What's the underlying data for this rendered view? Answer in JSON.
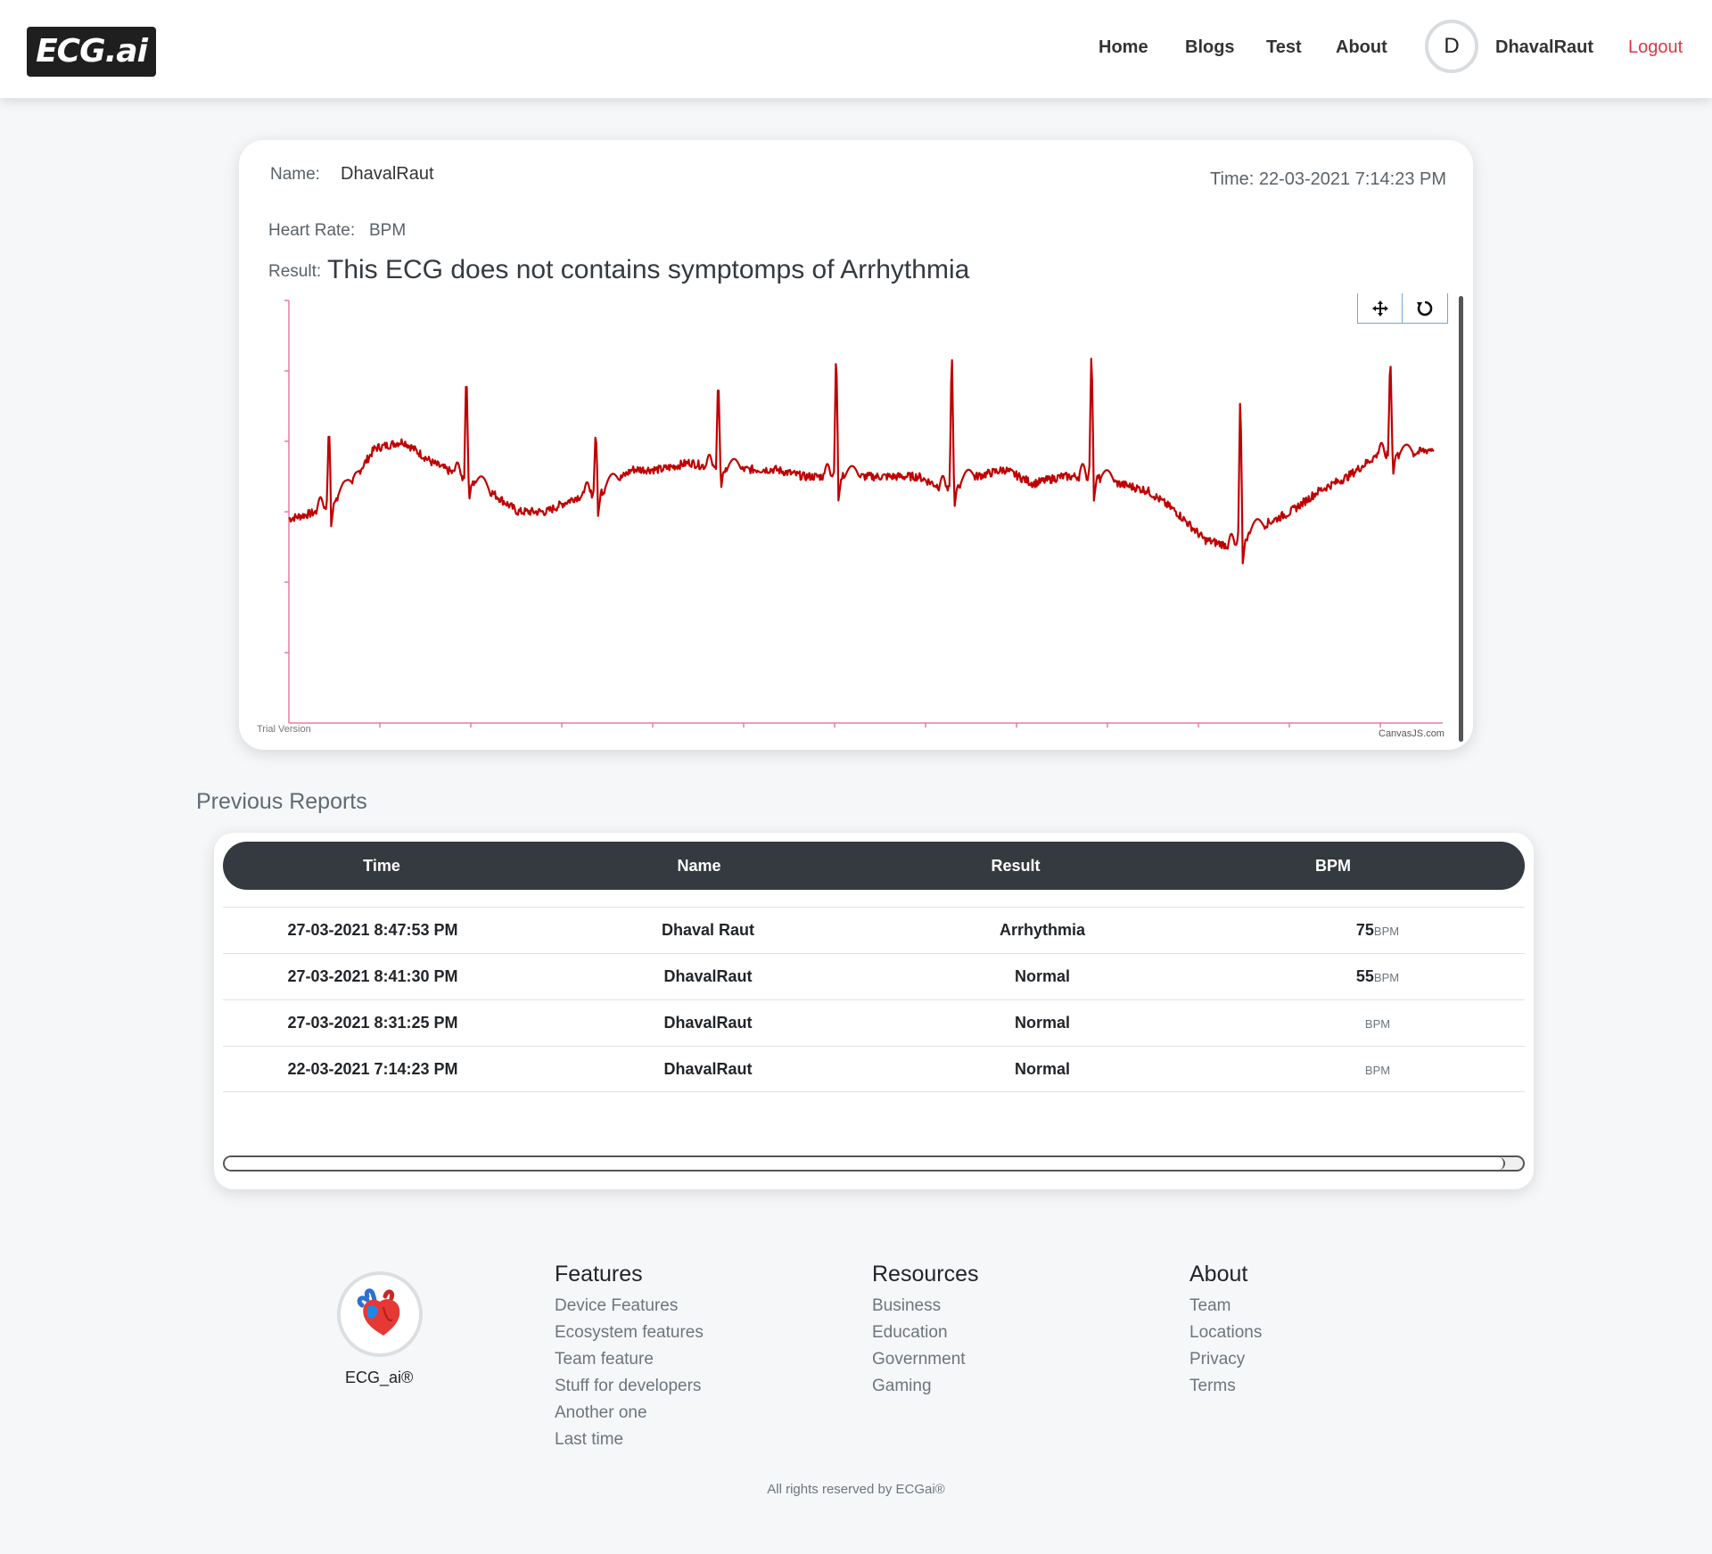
{
  "navbar": {
    "brand": "ECG.ai",
    "links": [
      "Home",
      "Blogs",
      "Test",
      "About"
    ],
    "avatar_initial": "D",
    "user": "DhavalRaut",
    "logout": "Logout"
  },
  "report": {
    "name_label": "Name:",
    "name_value": "DhavalRaut",
    "time_label": "Time: 22-03-2021 7:14:23 PM",
    "heart_rate_label": "Heart Rate:",
    "heart_rate_value": "BPM",
    "result_label": "Result:",
    "result_value": "This ECG does not contains symptomps of Arrhythmia",
    "chart_tools": [
      "pan-icon",
      "reset-icon"
    ],
    "watermark_left": "Trial Version",
    "watermark_right": "CanvasJS.com",
    "line_color": "#c00000",
    "axis_color": "#e87ba0"
  },
  "chart_data": {
    "type": "line",
    "title": "",
    "xlabel": "",
    "ylabel": "",
    "grid": false,
    "ylim": [
      0,
      6
    ],
    "baseline": [
      2.9,
      3.0,
      3.3,
      3.9,
      4.0,
      3.7,
      3.5,
      3.3,
      3.0,
      3.0,
      3.2,
      3.3,
      3.6,
      3.6,
      3.7,
      3.6,
      3.6,
      3.6,
      3.5,
      3.5,
      3.5,
      3.5,
      3.5,
      3.3,
      3.5,
      3.6,
      3.4,
      3.5,
      3.5,
      3.4,
      3.3,
      3.0,
      2.6,
      2.5,
      2.8,
      3.0,
      3.3,
      3.5,
      3.8,
      3.8,
      3.9
    ],
    "spikes": [
      {
        "x": 0.035,
        "y": 4.3
      },
      {
        "x": 0.155,
        "y": 5.1
      },
      {
        "x": 0.268,
        "y": 4.2
      },
      {
        "x": 0.375,
        "y": 5.0
      },
      {
        "x": 0.478,
        "y": 5.4
      },
      {
        "x": 0.579,
        "y": 5.4
      },
      {
        "x": 0.701,
        "y": 5.4
      },
      {
        "x": 0.831,
        "y": 4.8
      },
      {
        "x": 0.962,
        "y": 5.3
      }
    ]
  },
  "previous_reports": {
    "title": "Previous Reports",
    "columns": [
      "Time",
      "Name",
      "Result",
      "BPM"
    ],
    "bpm_unit": "BPM",
    "rows": [
      {
        "time": "27-03-2021 8:47:53 PM",
        "name": "Dhaval Raut",
        "result": "Arrhythmia",
        "bpm": "75"
      },
      {
        "time": "27-03-2021 8:41:30 PM",
        "name": "DhavalRaut",
        "result": "Normal",
        "bpm": "55"
      },
      {
        "time": "27-03-2021 8:31:25 PM",
        "name": "DhavalRaut",
        "result": "Normal",
        "bpm": ""
      },
      {
        "time": "22-03-2021 7:14:23 PM",
        "name": "DhavalRaut",
        "result": "Normal",
        "bpm": ""
      }
    ]
  },
  "footer": {
    "logo_text": "ECG_ai®",
    "columns": [
      {
        "heading": "Features",
        "items": [
          "Device Features",
          "Ecosystem features",
          "Team feature",
          "Stuff for developers",
          "Another one",
          "Last time"
        ]
      },
      {
        "heading": "Resources",
        "items": [
          "Business",
          "Education",
          "Government",
          "Gaming"
        ]
      },
      {
        "heading": "About",
        "items": [
          "Team",
          "Locations",
          "Privacy",
          "Terms"
        ]
      }
    ],
    "copyright": "All rights reserved by ECGai®"
  }
}
